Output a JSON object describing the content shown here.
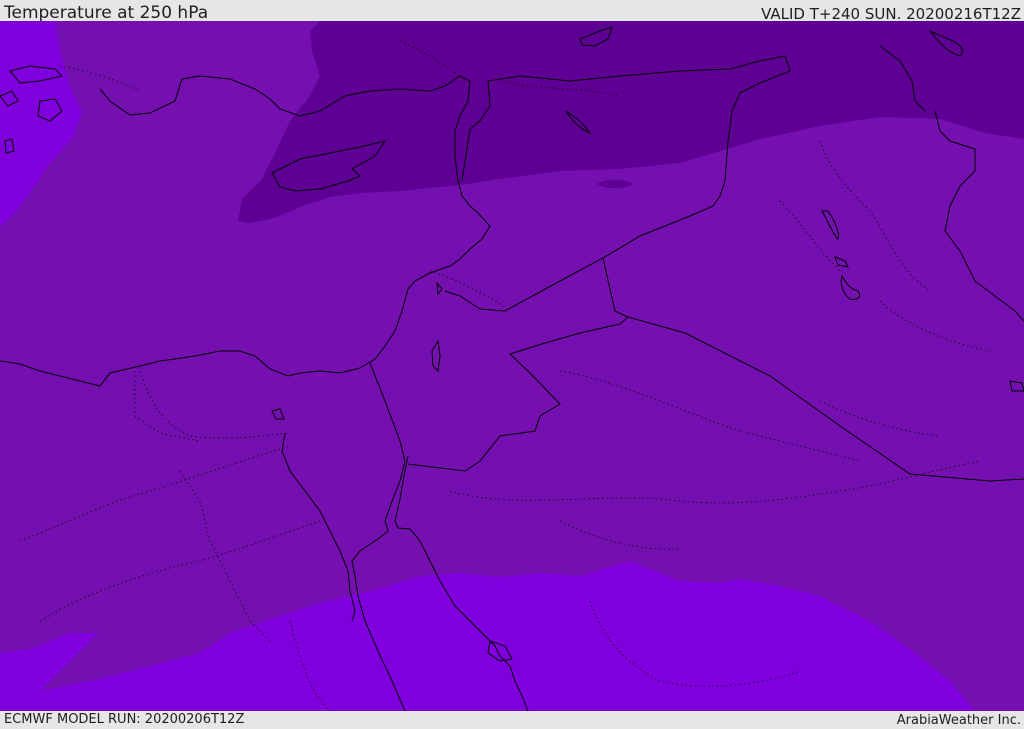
{
  "header": {
    "title": "Temperature at 250 hPa",
    "valid": "VALID T+240 SUN. 20200216T12Z"
  },
  "footer": {
    "model_run": "ECMWF MODEL RUN: 20200206T12Z",
    "credit": "ArabiaWeather Inc."
  },
  "map": {
    "field": "temperature-250hPa",
    "colors": {
      "dark_band": "#5f0095",
      "mid_band": "#7410b0",
      "bright_band": "#7f00dc",
      "coast_line": "#000000"
    }
  }
}
